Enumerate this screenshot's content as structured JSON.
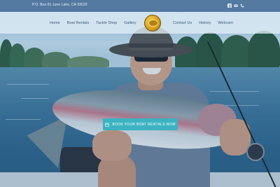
{
  "topbar": {
    "address": "P.O. Box 81 June Lake, CA 93529",
    "icons": [
      "facebook-icon",
      "email-icon",
      "phone-icon"
    ]
  },
  "nav": {
    "left": [
      "Home",
      "Boat Rentals",
      "Tackle Shop",
      "Gallery"
    ],
    "right": [
      "Contact Us",
      "History",
      "Webcam"
    ]
  },
  "logo": {
    "icon": "marina-logo-icon"
  },
  "hero": {
    "cta_label": "BOOK YOUR BOAT RENTALS NOW",
    "cta_icon": "calendar-icon"
  },
  "colors": {
    "topbar": "#5479a0",
    "nav_text": "#3d5b7a",
    "cta": "#3cb3c1",
    "overlay": "#1c60a0"
  }
}
